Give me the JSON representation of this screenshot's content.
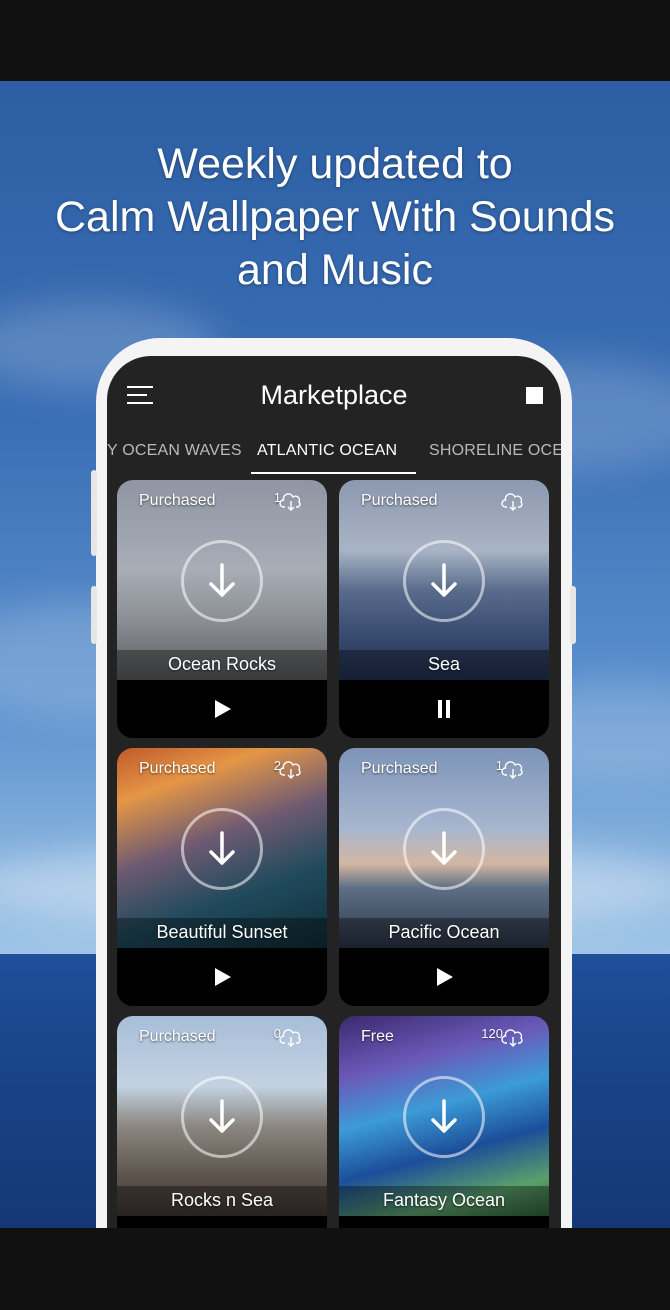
{
  "headline": {
    "line1": "Weekly updated to",
    "line2": "Calm Wallpaper With Sounds",
    "line3": "and Music"
  },
  "appbar": {
    "title": "Marketplace",
    "menu_icon": "hamburger-menu-icon",
    "stop_icon": "stop-icon"
  },
  "tabs": [
    {
      "label": "Y OCEAN WAVES",
      "active": false
    },
    {
      "label": "ATLANTIC OCEAN",
      "active": true
    },
    {
      "label": "SHORELINE OCEA",
      "active": false
    }
  ],
  "cards": [
    {
      "name": "Ocean Rocks",
      "status": "Purchased",
      "count": "1",
      "control": "play"
    },
    {
      "name": "Sea",
      "status": "Purchased",
      "count": "",
      "control": "pause"
    },
    {
      "name": "Beautiful Sunset",
      "status": "Purchased",
      "count": "2",
      "control": "play"
    },
    {
      "name": "Pacific Ocean",
      "status": "Purchased",
      "count": "1",
      "control": "play"
    },
    {
      "name": "Rocks n Sea",
      "status": "Purchased",
      "count": "0",
      "control": ""
    },
    {
      "name": "Fantasy Ocean",
      "status": "Free",
      "count": "120",
      "control": ""
    }
  ],
  "colors": {
    "screen_bg": "#232323",
    "accent": "#ffffff",
    "sky_top": "#2d5ea3",
    "sea": "#1a4489"
  }
}
